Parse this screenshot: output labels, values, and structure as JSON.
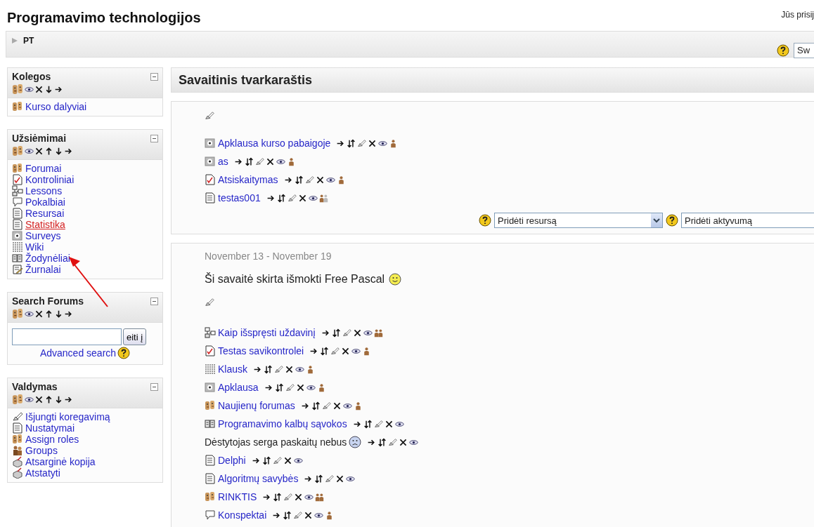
{
  "header": {
    "title": "Programavimo technologijos",
    "login_text": "Jūs prisij"
  },
  "navbar": {
    "breadcrumb": "PT",
    "switch_role": "Sw"
  },
  "blocks": [
    {
      "kind": "list",
      "title": "Kolegos",
      "can_move_up": false,
      "items": [
        {
          "kind": "forum",
          "label": "Kurso dalyviai",
          "hovered": false
        }
      ]
    },
    {
      "kind": "list",
      "title": "Užsiėmimai",
      "can_move_up": true,
      "items": [
        {
          "kind": "forum",
          "label": "Forumai",
          "hovered": false
        },
        {
          "kind": "quiz",
          "label": "Kontroliniai",
          "hovered": false
        },
        {
          "kind": "lesson",
          "label": "Lessons",
          "hovered": false
        },
        {
          "kind": "chat",
          "label": "Pokalbiai",
          "hovered": false
        },
        {
          "kind": "resource",
          "label": "Resursai",
          "hovered": false
        },
        {
          "kind": "resource",
          "label": "Statistika",
          "hovered": true
        },
        {
          "kind": "survey",
          "label": "Surveys",
          "hovered": false
        },
        {
          "kind": "wiki",
          "label": "Wiki",
          "hovered": false
        },
        {
          "kind": "glossary",
          "label": "Žodynėliai",
          "hovered": false
        },
        {
          "kind": "journal",
          "label": "Žurnalai",
          "hovered": false
        }
      ]
    },
    {
      "kind": "search",
      "title": "Search Forums",
      "can_move_up": true,
      "button": "eiti į",
      "link": "Advanced search"
    },
    {
      "kind": "list",
      "title": "Valdymas",
      "can_move_up": true,
      "items": [
        {
          "kind": "edit",
          "label": "Išjungti koregavimą",
          "hovered": false
        },
        {
          "kind": "settings",
          "label": "Nustatymai",
          "hovered": false
        },
        {
          "kind": "roles",
          "label": "Assign roles",
          "hovered": false
        },
        {
          "kind": "groups",
          "label": "Groups",
          "hovered": false
        },
        {
          "kind": "backup",
          "label": "Atsarginė kopija",
          "hovered": false
        },
        {
          "kind": "restore",
          "label": "Atstatyti",
          "hovered": false
        }
      ]
    }
  ],
  "main": {
    "title": "Savaitinis tvarkaraštis",
    "sections": [
      {
        "activities": [
          {
            "kind": "survey",
            "label": "Apklausa kurso pabaigoje",
            "group": {
              "kind": "none"
            }
          },
          {
            "kind": "survey",
            "label": "as",
            "group": {
              "kind": "none"
            }
          },
          {
            "kind": "quiz",
            "label": "Atsiskaitymas",
            "group": {
              "kind": "none"
            }
          },
          {
            "kind": "resource",
            "label": "testas001",
            "group": {
              "kind": "visible"
            }
          }
        ],
        "add_resource": "Pridėti resursą",
        "add_activity": "Pridėti aktyvumą"
      },
      {
        "date": "November 13 - November 19",
        "summary": {
          "text": "Ši savaitė skirta išmokti Free Pascal",
          "emoticon": {
            "kind": "smile"
          }
        },
        "activities": [
          {
            "kind": "lesson",
            "label": "Kaip išspręsti uždavinį",
            "group": {
              "kind": "separate"
            }
          },
          {
            "kind": "quiz",
            "label": "Testas savikontrolei",
            "group": {
              "kind": "none"
            }
          },
          {
            "kind": "wiki",
            "label": "Klausk",
            "group": {
              "kind": "none"
            }
          },
          {
            "kind": "survey",
            "label": "Apklausa",
            "group": {
              "kind": "none"
            }
          },
          {
            "kind": "forum",
            "label": "Naujienų forumas",
            "group": {
              "kind": "none"
            }
          },
          {
            "kind": "glossary",
            "label": "Programavimo kalbų sąvokos"
          },
          {
            "kind": "label",
            "label": "Dėstytojas serga paskaitų nebus",
            "emoticon": {
              "kind": "sad"
            }
          },
          {
            "kind": "resource",
            "label": "Delphi"
          },
          {
            "kind": "resource",
            "label": "Algoritmų savybės"
          },
          {
            "kind": "forum",
            "label": "RINKTIS",
            "group": {
              "kind": "separate"
            }
          },
          {
            "kind": "chat",
            "label": "Konspektai",
            "group": {
              "kind": "none"
            }
          }
        ]
      }
    ]
  }
}
